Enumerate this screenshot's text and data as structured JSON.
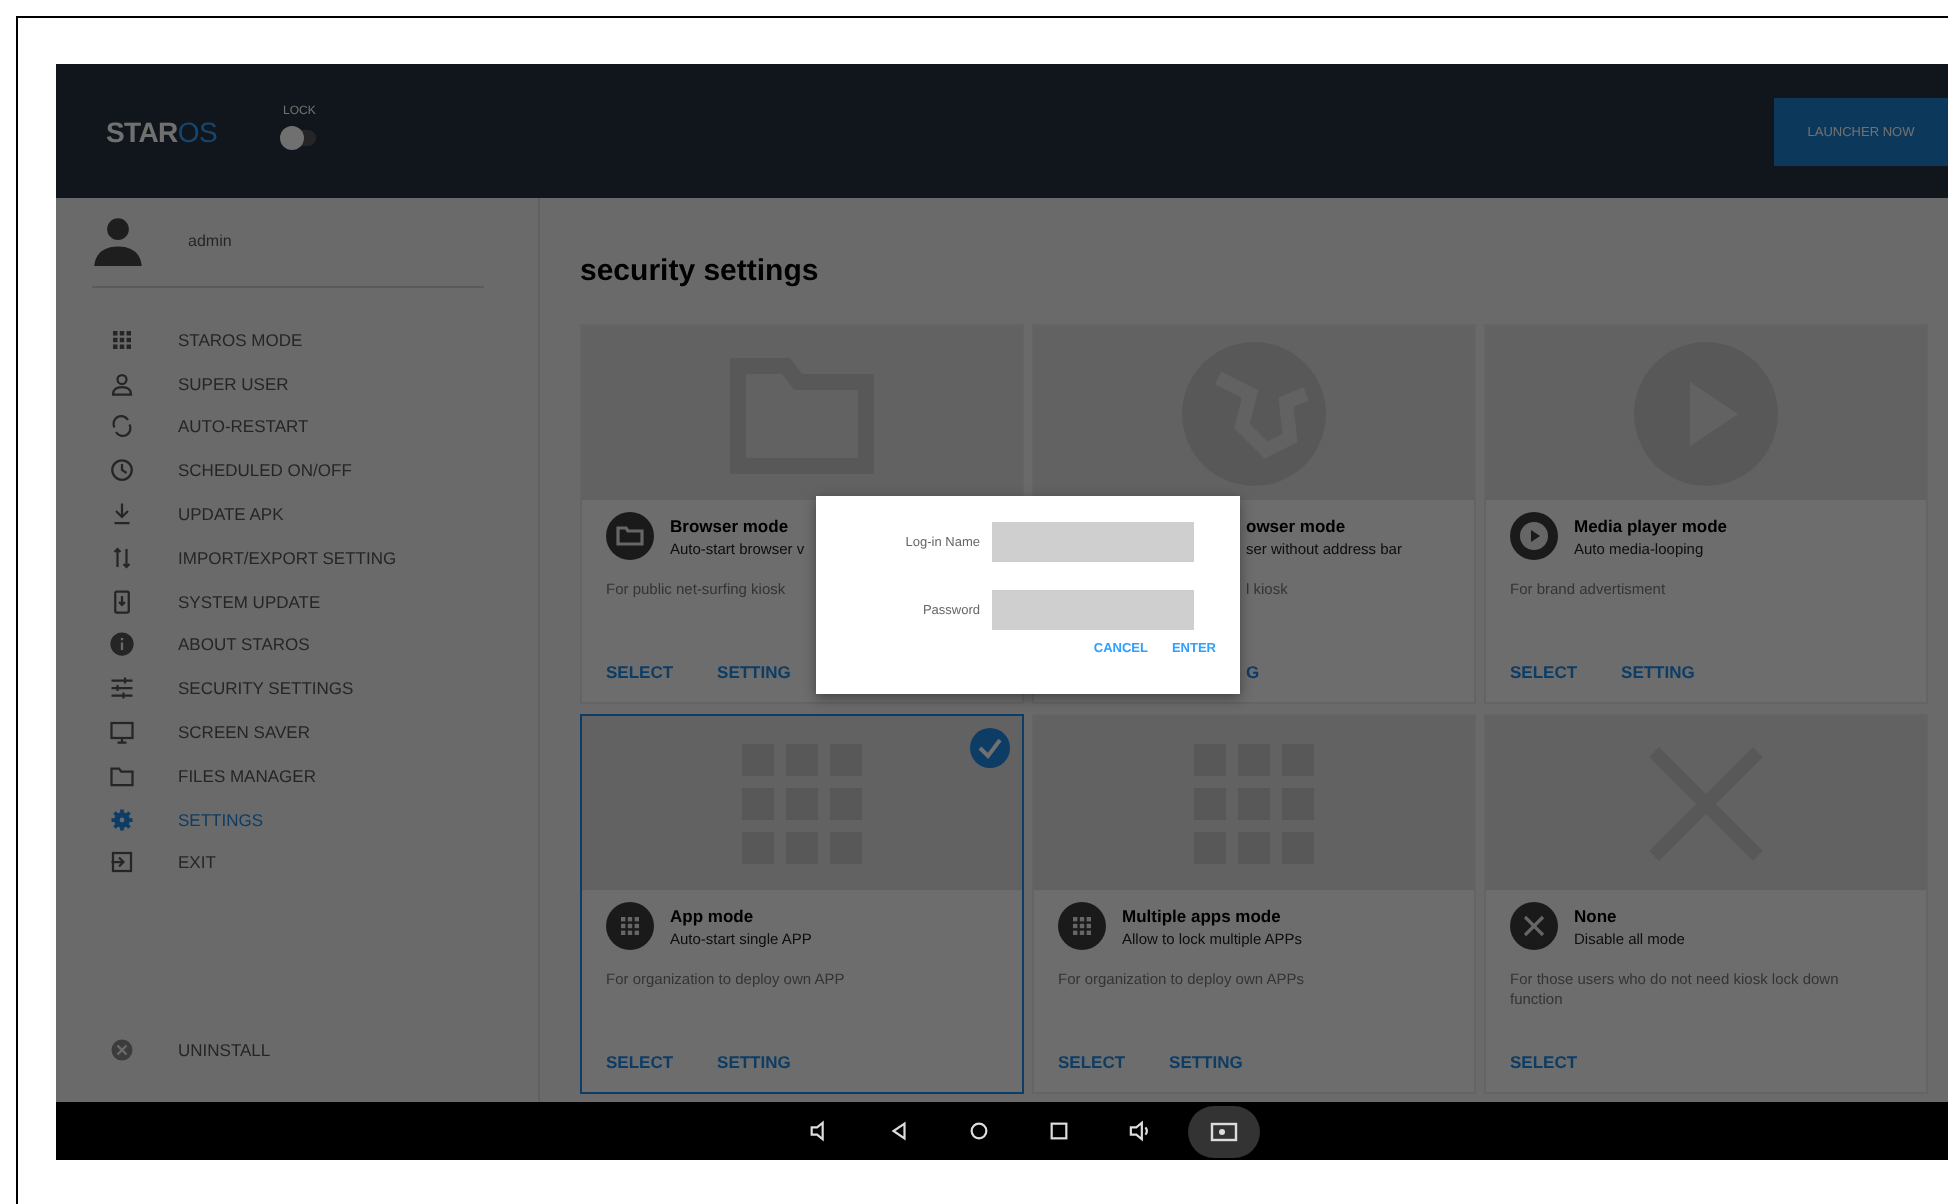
{
  "header": {
    "logo": {
      "main": "STAR",
      "accent": "OS"
    },
    "lock": {
      "label": "LOCK",
      "on": false
    },
    "launcher_button": "LAUNCHER NOW"
  },
  "sidebar": {
    "user": "admin",
    "items": [
      {
        "label": "STAROS MODE",
        "kind": "grid",
        "selected": false
      },
      {
        "label": "SUPER USER",
        "kind": "person",
        "selected": false
      },
      {
        "label": "AUTO-RESTART",
        "kind": "refresh",
        "selected": false
      },
      {
        "label": "SCHEDULED ON/OFF",
        "kind": "clock",
        "selected": false
      },
      {
        "label": "UPDATE APK",
        "kind": "download",
        "selected": false
      },
      {
        "label": "IMPORT/EXPORT SETTING",
        "kind": "arrows",
        "selected": false
      },
      {
        "label": "SYSTEM UPDATE",
        "kind": "phone",
        "selected": false
      },
      {
        "label": "ABOUT STAROS",
        "kind": "info",
        "selected": false
      },
      {
        "label": "SECURITY SETTINGS",
        "kind": "sliders",
        "selected": false
      },
      {
        "label": "SCREEN SAVER",
        "kind": "monitor",
        "selected": false
      },
      {
        "label": "FILES MANAGER",
        "kind": "folder",
        "selected": false
      },
      {
        "label": "SETTINGS",
        "kind": "gear",
        "selected": true
      },
      {
        "label": "EXIT",
        "kind": "exit",
        "selected": false
      }
    ],
    "uninstall": "UNINSTALL"
  },
  "page_title": "security settings",
  "modes": [
    {
      "kind": "folder",
      "title": "Browser mode",
      "subtitle": "Auto-start browser v",
      "description": "For public net-surfing kiosk",
      "actions": [
        "SELECT",
        "SETTING"
      ],
      "selected": false
    },
    {
      "kind": "globe",
      "title": "owser mode",
      "subtitle": "ser without address bar",
      "description": "l kiosk",
      "actions": [
        "G"
      ],
      "selected": false,
      "covered": true
    },
    {
      "kind": "play",
      "title": "Media player mode",
      "subtitle": "Auto media-looping",
      "description": "For brand advertisment",
      "actions": [
        "SELECT",
        "SETTING"
      ],
      "selected": false
    },
    {
      "kind": "grid",
      "title": "App mode",
      "subtitle": "Auto-start single APP",
      "description": "For organization to deploy own APP",
      "actions": [
        "SELECT",
        "SETTING"
      ],
      "selected": true
    },
    {
      "kind": "grid",
      "title": "Multiple apps mode",
      "subtitle": "Allow to lock multiple APPs",
      "description": "For organization to deploy own APPs",
      "actions": [
        "SELECT",
        "SETTING"
      ],
      "selected": false
    },
    {
      "kind": "close",
      "title": "None",
      "subtitle": "Disable all mode",
      "description": "For those users who do not need kiosk lock down function",
      "actions": [
        "SELECT"
      ],
      "selected": false
    }
  ],
  "dialog": {
    "fields": [
      {
        "label": "Log-in Name"
      },
      {
        "label": "Password"
      }
    ],
    "buttons": [
      "CANCEL",
      "ENTER"
    ]
  }
}
